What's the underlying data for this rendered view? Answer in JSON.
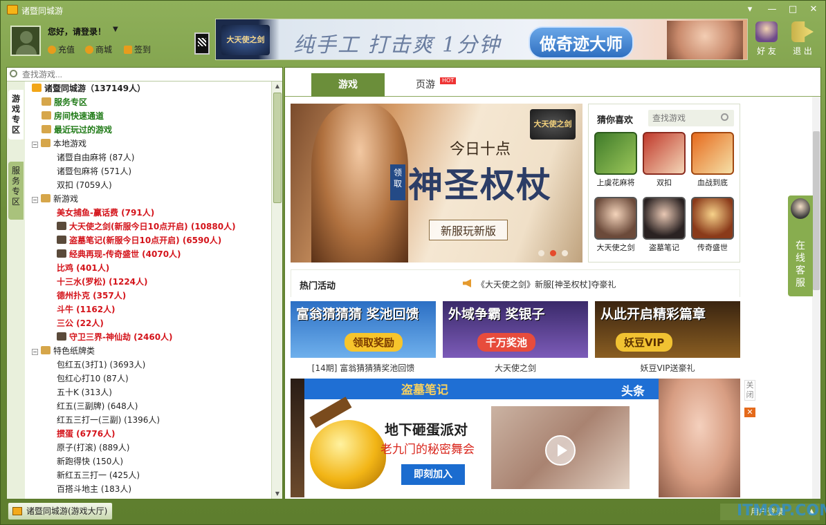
{
  "window": {
    "title": "诸暨同城游",
    "controls": [
      "▾",
      "—",
      "□",
      "✕"
    ]
  },
  "user": {
    "greeting": "您好，请登录！",
    "links": [
      "充值",
      "商城",
      "签到"
    ]
  },
  "top_banner": {
    "game_logo": "大天使之剑",
    "slogan": "纯手工 打击爽 1分钟",
    "badge": "做奇迹大师"
  },
  "right_tools": [
    {
      "label": "好 友",
      "icon": "friends-icon"
    },
    {
      "label": "退 出",
      "icon": "exit-icon"
    }
  ],
  "sidebar": {
    "search_placeholder": "查找游戏...",
    "vtabs": [
      "游戏专区",
      "服务专区"
    ],
    "tree": [
      {
        "label": "诸暨同城游（137149人）",
        "level": 0,
        "style": "bold"
      },
      {
        "label": "服务专区",
        "level": 1,
        "style": "green"
      },
      {
        "label": "房间快速通道",
        "level": 1,
        "style": "green"
      },
      {
        "label": "最近玩过的游戏",
        "level": 1,
        "style": "green"
      },
      {
        "label": "本地游戏",
        "level": 1,
        "style": "normal",
        "expander": "−"
      },
      {
        "label": "诸暨自由麻将 (87人)",
        "level": 2,
        "style": "normal"
      },
      {
        "label": "诸暨包麻将 (571人)",
        "level": 2,
        "style": "normal"
      },
      {
        "label": "双扣 (7059人)",
        "level": 2,
        "style": "normal"
      },
      {
        "label": "新游戏",
        "level": 1,
        "style": "normal",
        "expander": "−"
      },
      {
        "label": "美女捕鱼-赢话费 (791人)",
        "level": 2,
        "style": "red"
      },
      {
        "label": "大天使之剑(新服今日10点开启) (10880人)",
        "level": 2,
        "style": "red"
      },
      {
        "label": "盗墓笔记(新服今日10点开启) (6590人)",
        "level": 2,
        "style": "red"
      },
      {
        "label": "经典再现-传奇盛世 (4070人)",
        "level": 2,
        "style": "red"
      },
      {
        "label": "比鸡 (401人)",
        "level": 2,
        "style": "red"
      },
      {
        "label": "十三水(罗松) (1224人)",
        "level": 2,
        "style": "red"
      },
      {
        "label": "德州扑克 (357人)",
        "level": 2,
        "style": "red"
      },
      {
        "label": "斗牛 (1162人)",
        "level": 2,
        "style": "red"
      },
      {
        "label": "三公 (22人)",
        "level": 2,
        "style": "red"
      },
      {
        "label": "守卫三界-神仙劫 (2460人)",
        "level": 2,
        "style": "red"
      },
      {
        "label": "特色纸牌类",
        "level": 1,
        "style": "normal",
        "expander": "−"
      },
      {
        "label": "包红五(3打1) (3693人)",
        "level": 2,
        "style": "normal"
      },
      {
        "label": "包红心打10 (87人)",
        "level": 2,
        "style": "normal"
      },
      {
        "label": "五十K (313人)",
        "level": 2,
        "style": "normal"
      },
      {
        "label": "红五(三副牌) (648人)",
        "level": 2,
        "style": "normal"
      },
      {
        "label": "红五三打一(三副) (1396人)",
        "level": 2,
        "style": "normal"
      },
      {
        "label": "掼蛋 (6776人)",
        "level": 2,
        "style": "red"
      },
      {
        "label": "原子(打滚) (889人)",
        "level": 2,
        "style": "normal"
      },
      {
        "label": "新跑得快 (150人)",
        "level": 2,
        "style": "normal"
      },
      {
        "label": "新红五三打一 (425人)",
        "level": 2,
        "style": "normal"
      },
      {
        "label": "百搭斗地主 (183人)",
        "level": 2,
        "style": "normal"
      }
    ]
  },
  "main": {
    "tabs": [
      "游戏",
      "页游"
    ],
    "hot_badge": "HOT",
    "hero": {
      "game_logo": "大天使之剑",
      "line1": "今日十点",
      "tag": "领取",
      "line2": "神圣权杖",
      "line3": "新服玩新版"
    },
    "guess": {
      "title": "猜你喜欢",
      "search_placeholder": "查找游戏",
      "games": [
        "上虞花麻将",
        "双扣",
        "血战到底",
        "大天使之剑",
        "盗墓笔记",
        "传奇盛世"
      ]
    },
    "hot_activity": {
      "title": "热门活动",
      "news": "《大天使之剑》新服[神圣权杖]夺豪礼"
    },
    "promos": [
      {
        "big": "富翁猜猜猜 奖池回馈",
        "btn": "领取奖励",
        "caption": "[14期] 富翁猜猜猜奖池回馈"
      },
      {
        "big": "外域争霸 奖银子",
        "btn": "千万奖池",
        "caption": "大天使之剑"
      },
      {
        "big": "从此开启精彩篇章",
        "btn": "妖豆VIP",
        "caption": "妖豆VIP送豪礼"
      }
    ],
    "ad": {
      "logo": "盗墓笔记",
      "headline": "头条",
      "title": "地下砸蛋派对",
      "subtitle": "老九门的秘密舞会",
      "button": "即刻加入"
    },
    "close_label": "关闭",
    "close_x": "✕"
  },
  "service": {
    "label": "在线客服"
  },
  "status": {
    "tab": "诸暨同城游(游戏大厅)",
    "login": "用户登录",
    "watermark": "ITMOP.COM"
  }
}
